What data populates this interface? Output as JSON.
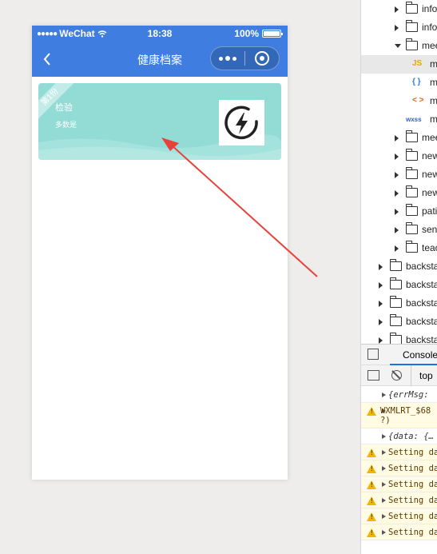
{
  "status_bar": {
    "carrier": "WeChat",
    "time": "18:38",
    "battery": "100%"
  },
  "navbar": {
    "title": "健康档案"
  },
  "card": {
    "badge": "第1份",
    "name": "检验",
    "subtitle": "多数是"
  },
  "annotation": {
    "color": "#e8423c"
  },
  "colors": {
    "navbar": "#3f7ee0",
    "card": "#93dbd5"
  },
  "file_tree": [
    {
      "label": "info",
      "type": "folder",
      "state": "collapsed"
    },
    {
      "label": "info",
      "type": "folder",
      "state": "collapsed"
    },
    {
      "label": "mee",
      "type": "folder",
      "state": "expanded"
    },
    {
      "label": "m",
      "type": "js",
      "icon_text": "JS",
      "selected": true
    },
    {
      "label": "m",
      "type": "json",
      "icon_text": "{ }"
    },
    {
      "label": "m",
      "type": "wxml",
      "icon_text": "< >"
    },
    {
      "label": "m",
      "type": "wxss",
      "icon_text": "wxss"
    },
    {
      "label": "mee",
      "type": "folder",
      "state": "collapsed"
    },
    {
      "label": "new",
      "type": "folder",
      "state": "collapsed"
    },
    {
      "label": "new",
      "type": "folder",
      "state": "collapsed"
    },
    {
      "label": "new",
      "type": "folder",
      "state": "collapsed"
    },
    {
      "label": "pati",
      "type": "folder",
      "state": "collapsed"
    },
    {
      "label": "sen",
      "type": "folder",
      "state": "collapsed"
    },
    {
      "label": "teac",
      "type": "folder",
      "state": "collapsed"
    },
    {
      "label": "backsta",
      "type": "folder",
      "state": "collapsed"
    },
    {
      "label": "backsta",
      "type": "folder",
      "state": "collapsed"
    },
    {
      "label": "backsta",
      "type": "folder",
      "state": "collapsed"
    },
    {
      "label": "backsta",
      "type": "folder",
      "state": "collapsed"
    },
    {
      "label": "backsta",
      "type": "folder",
      "state": "collapsed"
    }
  ],
  "devtools": {
    "console_tab": "Console",
    "context": "top"
  },
  "console_messages": [
    {
      "level": "info",
      "lines": [
        "{errMsg: "
      ]
    },
    {
      "level": "warn",
      "lines": [
        "WXMLRT_$68",
        "?)"
      ]
    },
    {
      "level": "info",
      "lines": [
        "{data: {…"
      ]
    },
    {
      "level": "warn",
      "lines": [
        "Setting da"
      ]
    },
    {
      "level": "warn",
      "lines": [
        "Setting da"
      ]
    },
    {
      "level": "warn",
      "lines": [
        "Setting da"
      ]
    },
    {
      "level": "warn",
      "lines": [
        "Setting da"
      ]
    },
    {
      "level": "warn",
      "lines": [
        "Setting da"
      ]
    },
    {
      "level": "warn",
      "lines": [
        "Setting da"
      ]
    }
  ]
}
